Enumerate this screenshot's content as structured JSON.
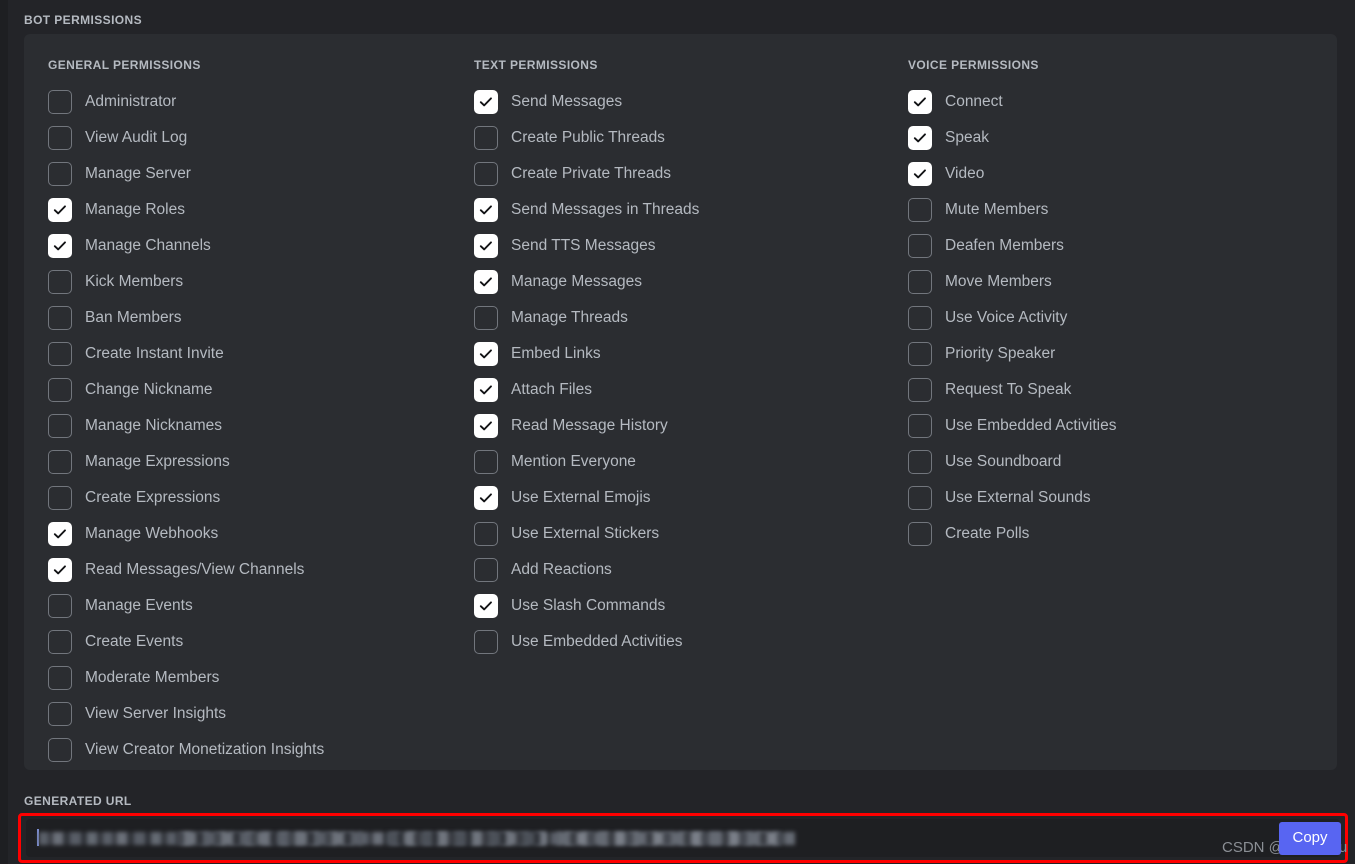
{
  "section": {
    "header": "BOT PERMISSIONS"
  },
  "colors": {
    "accent": "#5865f2",
    "highlight_border": "#ff0000",
    "panel_bg": "#2b2d31",
    "page_bg": "#232428",
    "field_bg": "#1e1f22",
    "label_text": "#b5bac1",
    "checkbox_on_bg": "#ffffff",
    "checkbox_off_border": "#72767d"
  },
  "columns": [
    {
      "key": "general",
      "title": "GENERAL PERMISSIONS",
      "items": [
        {
          "label": "Administrator",
          "checked": false
        },
        {
          "label": "View Audit Log",
          "checked": false
        },
        {
          "label": "Manage Server",
          "checked": false
        },
        {
          "label": "Manage Roles",
          "checked": true
        },
        {
          "label": "Manage Channels",
          "checked": true
        },
        {
          "label": "Kick Members",
          "checked": false
        },
        {
          "label": "Ban Members",
          "checked": false
        },
        {
          "label": "Create Instant Invite",
          "checked": false
        },
        {
          "label": "Change Nickname",
          "checked": false
        },
        {
          "label": "Manage Nicknames",
          "checked": false
        },
        {
          "label": "Manage Expressions",
          "checked": false
        },
        {
          "label": "Create Expressions",
          "checked": false
        },
        {
          "label": "Manage Webhooks",
          "checked": true
        },
        {
          "label": "Read Messages/View Channels",
          "checked": true
        },
        {
          "label": "Manage Events",
          "checked": false
        },
        {
          "label": "Create Events",
          "checked": false
        },
        {
          "label": "Moderate Members",
          "checked": false
        },
        {
          "label": "View Server Insights",
          "checked": false
        },
        {
          "label": "View Creator Monetization Insights",
          "checked": false
        }
      ]
    },
    {
      "key": "text",
      "title": "TEXT PERMISSIONS",
      "items": [
        {
          "label": "Send Messages",
          "checked": true
        },
        {
          "label": "Create Public Threads",
          "checked": false
        },
        {
          "label": "Create Private Threads",
          "checked": false
        },
        {
          "label": "Send Messages in Threads",
          "checked": true
        },
        {
          "label": "Send TTS Messages",
          "checked": true
        },
        {
          "label": "Manage Messages",
          "checked": true
        },
        {
          "label": "Manage Threads",
          "checked": false
        },
        {
          "label": "Embed Links",
          "checked": true
        },
        {
          "label": "Attach Files",
          "checked": true
        },
        {
          "label": "Read Message History",
          "checked": true
        },
        {
          "label": "Mention Everyone",
          "checked": false
        },
        {
          "label": "Use External Emojis",
          "checked": true
        },
        {
          "label": "Use External Stickers",
          "checked": false
        },
        {
          "label": "Add Reactions",
          "checked": false
        },
        {
          "label": "Use Slash Commands",
          "checked": true
        },
        {
          "label": "Use Embedded Activities",
          "checked": false
        }
      ]
    },
    {
      "key": "voice",
      "title": "VOICE PERMISSIONS",
      "items": [
        {
          "label": "Connect",
          "checked": true
        },
        {
          "label": "Speak",
          "checked": true
        },
        {
          "label": "Video",
          "checked": true
        },
        {
          "label": "Mute Members",
          "checked": false
        },
        {
          "label": "Deafen Members",
          "checked": false
        },
        {
          "label": "Move Members",
          "checked": false
        },
        {
          "label": "Use Voice Activity",
          "checked": false
        },
        {
          "label": "Priority Speaker",
          "checked": false
        },
        {
          "label": "Request To Speak",
          "checked": false
        },
        {
          "label": "Use Embedded Activities",
          "checked": false
        },
        {
          "label": "Use Soundboard",
          "checked": false
        },
        {
          "label": "Use External Sounds",
          "checked": false
        },
        {
          "label": "Create Polls",
          "checked": false
        }
      ]
    }
  ],
  "generated_url": {
    "header": "GENERATED URL",
    "value": "",
    "redacted": true,
    "copy_label": "Copy"
  },
  "watermark": {
    "text": "CSDN @GISer Liu"
  }
}
